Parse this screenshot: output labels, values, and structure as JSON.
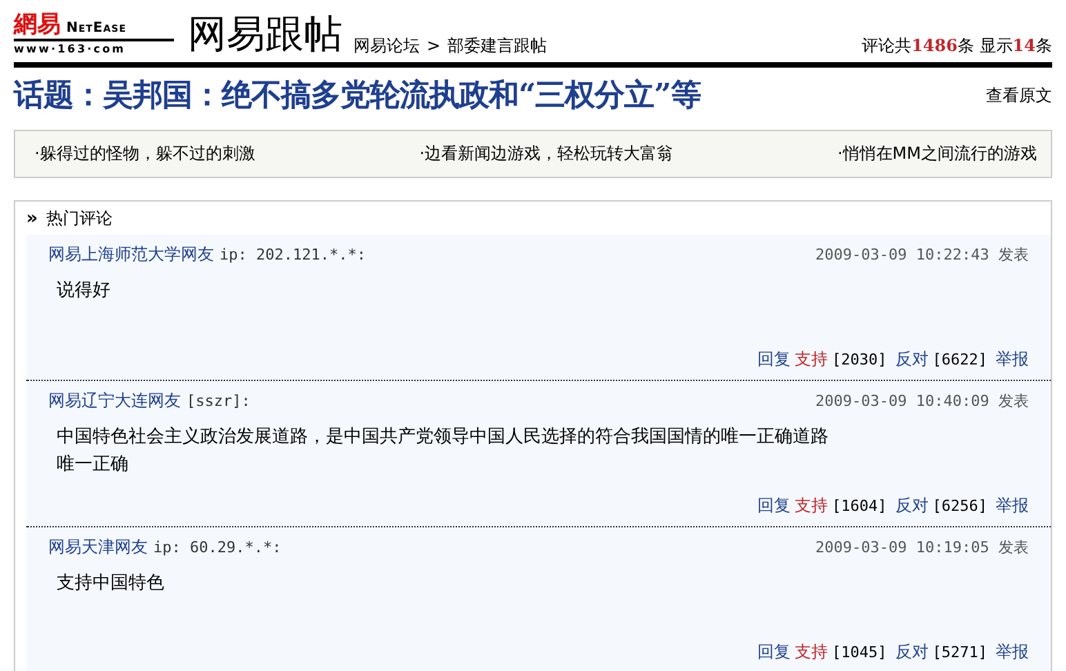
{
  "logo": {
    "mark": "網易",
    "brand": "NetEase",
    "url": "www·163·com"
  },
  "site_title": "网易跟帖",
  "breadcrumb": [
    {
      "label": "网易论坛"
    },
    {
      "label": "部委建言跟帖"
    }
  ],
  "breadcrumb_separator": ">",
  "count": [
    {
      "kind": "text",
      "text": "评论共"
    },
    {
      "kind": "number",
      "text": "1486"
    },
    {
      "kind": "text",
      "text": "条 显示"
    },
    {
      "kind": "number",
      "text": "14"
    },
    {
      "kind": "text",
      "text": "条"
    }
  ],
  "topic": {
    "title": "话题：吴邦国：绝不搞多党轮流执政和“三权分立”等",
    "link": "查看原文"
  },
  "promos": [
    "·躲得过的怪物，躲不过的刺激",
    "·边看新闻边游戏，轻松玩转大富翁",
    "·悄悄在MM之间流行的游戏"
  ],
  "hot": {
    "marker": "»",
    "title": "热门评论"
  },
  "comments": [
    {
      "author": "网易上海师范大学网友",
      "meta": "ip: 202.121.*.*:",
      "time": "2009-03-09 10:22:43 发表",
      "body": [
        "说得好"
      ],
      "reply": "回复",
      "support": "支持",
      "support_count": "[2030]",
      "oppose": "反对",
      "oppose_count": "[6622]",
      "report": "举报"
    },
    {
      "author": "网易辽宁大连网友",
      "meta": "[sszr]:",
      "time": "2009-03-09 10:40:09 发表",
      "body": [
        "中国特色社会主义政治发展道路，是中国共产党领导中国人民选择的符合我国国情的唯一正确道路",
        "唯一正确"
      ],
      "reply": "回复",
      "support": "支持",
      "support_count": "[1604]",
      "oppose": "反对",
      "oppose_count": "[6256]",
      "report": "举报"
    },
    {
      "author": "网易天津网友",
      "meta": "ip: 60.29.*.*:",
      "time": "2009-03-09 10:19:05 发表",
      "body": [
        "支持中国特色"
      ],
      "reply": "回复",
      "support": "支持",
      "support_count": "[1045]",
      "oppose": "反对",
      "oppose_count": "[5271]",
      "report": "举报"
    }
  ]
}
